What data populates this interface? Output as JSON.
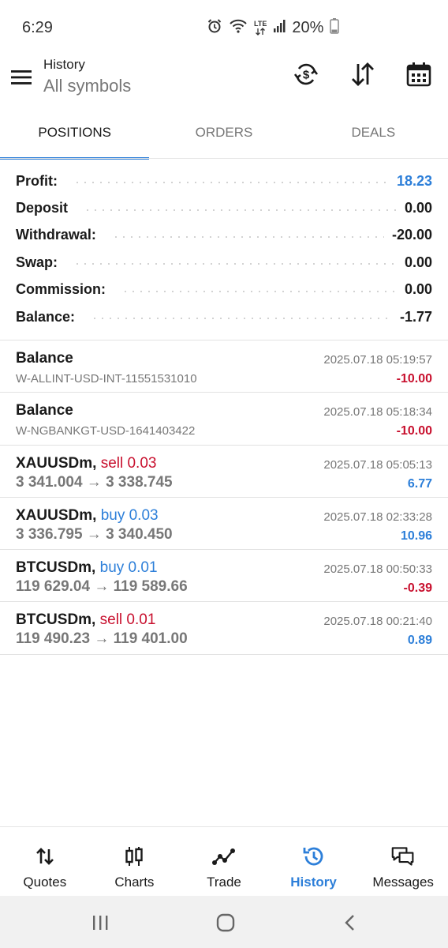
{
  "status_bar": {
    "time": "6:29",
    "lte": "LTE",
    "battery": "20%"
  },
  "header": {
    "title": "History",
    "subtitle": "All symbols",
    "icons": [
      "menu-icon",
      "currency-sync-icon",
      "sort-icon",
      "calendar-icon"
    ]
  },
  "tabs": [
    {
      "label": "POSITIONS",
      "active": true
    },
    {
      "label": "ORDERS",
      "active": false
    },
    {
      "label": "DEALS",
      "active": false
    }
  ],
  "summary": {
    "profit": {
      "label": "Profit:",
      "value": "18.23"
    },
    "deposit": {
      "label": "Deposit",
      "value": "0.00"
    },
    "withdrawal": {
      "label": "Withdrawal:",
      "value": "-20.00"
    },
    "swap": {
      "label": "Swap:",
      "value": "0.00"
    },
    "commission": {
      "label": "Commission:",
      "value": "0.00"
    },
    "balance": {
      "label": "Balance:",
      "value": "-1.77"
    }
  },
  "items": [
    {
      "title": "Balance",
      "side": "",
      "sub": "W-ALLINT-USD-INT-11551531010",
      "time": "2025.07.18 05:19:57",
      "amount": "-10.00"
    },
    {
      "title": "Balance",
      "side": "",
      "sub": "W-NGBANKGT-USD-1641403422",
      "time": "2025.07.18 05:18:34",
      "amount": "-10.00"
    },
    {
      "title": "XAUUSDm,",
      "side": "sell 0.03",
      "sub": "3 341.004 → 3 338.745",
      "time": "2025.07.18 05:05:13",
      "amount": "6.77"
    },
    {
      "title": "XAUUSDm,",
      "side": "buy 0.03",
      "sub": "3 336.795 → 3 340.450",
      "time": "2025.07.18 02:33:28",
      "amount": "10.96"
    },
    {
      "title": "BTCUSDm,",
      "side": "buy 0.01",
      "sub": "119 629.04 → 119 589.66",
      "time": "2025.07.18 00:50:33",
      "amount": "-0.39"
    },
    {
      "title": "BTCUSDm,",
      "side": "sell 0.01",
      "sub": "119 490.23 → 119 401.00",
      "time": "2025.07.18 00:21:40",
      "amount": "0.89"
    }
  ],
  "bottom_nav": [
    {
      "label": "Quotes",
      "icon": "quotes-icon"
    },
    {
      "label": "Charts",
      "icon": "charts-icon"
    },
    {
      "label": "Trade",
      "icon": "trade-icon"
    },
    {
      "label": "History",
      "icon": "history-icon",
      "active": true
    },
    {
      "label": "Messages",
      "icon": "messages-icon"
    }
  ],
  "colors": {
    "accent": "#2d7fd9",
    "sell": "#c8102e",
    "muted": "#777777"
  }
}
